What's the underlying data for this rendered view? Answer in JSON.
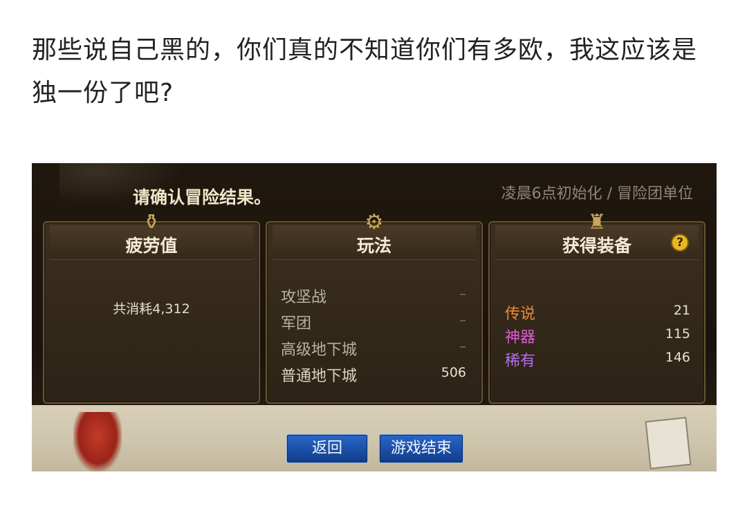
{
  "post": {
    "text": "那些说自己黑的，你们真的不知道你们有多欧，我这应该是独一份了吧?"
  },
  "dialog": {
    "title": "请确认冒险结果。",
    "note": "凌晨6点初始化 / 冒险团单位"
  },
  "fatigue_panel": {
    "title": "疲劳值",
    "line": "共消耗4,312",
    "emblem_icon": "potion-icon"
  },
  "mode_panel": {
    "title": "玩法",
    "emblem_icon": "gear-sword-icon",
    "rows": [
      {
        "name": "攻坚战",
        "value": "–"
      },
      {
        "name": "军团",
        "value": "–"
      },
      {
        "name": "高级地下城",
        "value": "–"
      },
      {
        "name": "普通地下城",
        "value": "506"
      }
    ]
  },
  "equip_panel": {
    "title": "获得装备",
    "emblem_icon": "armor-icon",
    "help_label": "?",
    "rows": [
      {
        "name": "传说",
        "value": "21",
        "color": "#f08a3c"
      },
      {
        "name": "神器",
        "value": "115",
        "color": "#e05ad8"
      },
      {
        "name": "稀有",
        "value": "146",
        "color": "#b56cf0"
      }
    ]
  },
  "buttons": {
    "back": "返回",
    "end_game": "游戏结束"
  },
  "colors": {
    "panel_bg": "#2c2316",
    "panel_border": "#6b5533",
    "button_blue": "#1b4fa6",
    "help_yellow": "#e8b820"
  }
}
